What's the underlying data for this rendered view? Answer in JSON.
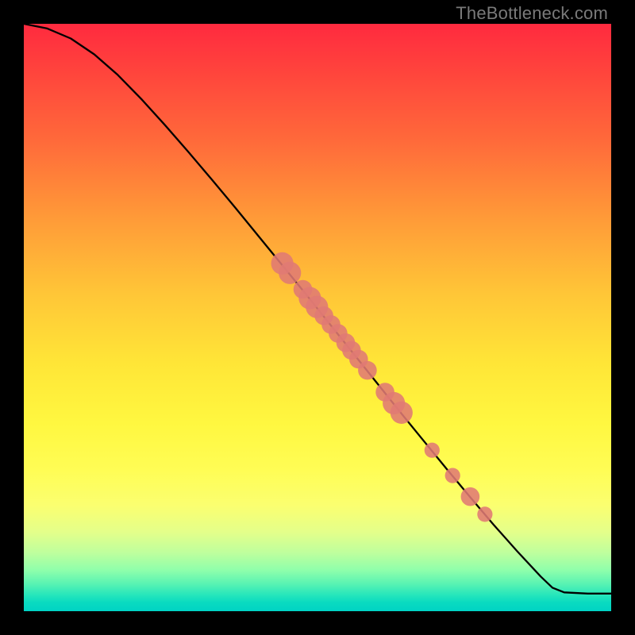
{
  "watermark": "TheBottleneck.com",
  "colors": {
    "dot": "#e07a74",
    "curve": "#000000"
  },
  "chart_data": {
    "type": "line",
    "title": "",
    "xlabel": "",
    "ylabel": "",
    "xlim": [
      0,
      100
    ],
    "ylim": [
      0,
      100
    ],
    "grid": false,
    "legend": null,
    "series": [
      {
        "name": "curve",
        "x": [
          0,
          4,
          8,
          12,
          16,
          20,
          24,
          28,
          32,
          36,
          40,
          44,
          48,
          52,
          56,
          60,
          64,
          68,
          72,
          76,
          80,
          84,
          88,
          90,
          92,
          96,
          100
        ],
        "y": [
          100,
          99.2,
          97.5,
          94.8,
          91.3,
          87.2,
          82.8,
          78.2,
          73.5,
          68.7,
          63.8,
          58.9,
          54.0,
          49.0,
          44.0,
          39.0,
          34.0,
          29.1,
          24.2,
          19.4,
          14.7,
          10.2,
          5.9,
          4.0,
          3.2,
          3.0,
          3.0
        ]
      }
    ],
    "points": [
      {
        "x": 44.0,
        "y": 59.2,
        "r": 1.9
      },
      {
        "x": 45.3,
        "y": 57.6,
        "r": 1.9
      },
      {
        "x": 47.5,
        "y": 54.8,
        "r": 1.6
      },
      {
        "x": 48.7,
        "y": 53.3,
        "r": 1.9
      },
      {
        "x": 49.9,
        "y": 51.8,
        "r": 1.9
      },
      {
        "x": 51.1,
        "y": 50.3,
        "r": 1.6
      },
      {
        "x": 52.3,
        "y": 48.8,
        "r": 1.6
      },
      {
        "x": 53.5,
        "y": 47.3,
        "r": 1.6
      },
      {
        "x": 54.8,
        "y": 45.7,
        "r": 1.6
      },
      {
        "x": 55.8,
        "y": 44.4,
        "r": 1.6
      },
      {
        "x": 57.0,
        "y": 42.9,
        "r": 1.6
      },
      {
        "x": 58.5,
        "y": 41.0,
        "r": 1.6
      },
      {
        "x": 61.5,
        "y": 37.3,
        "r": 1.6
      },
      {
        "x": 63.0,
        "y": 35.4,
        "r": 1.9
      },
      {
        "x": 64.3,
        "y": 33.8,
        "r": 1.9
      },
      {
        "x": 69.5,
        "y": 27.4,
        "r": 1.3
      },
      {
        "x": 73.0,
        "y": 23.1,
        "r": 1.3
      },
      {
        "x": 76.0,
        "y": 19.5,
        "r": 1.6
      },
      {
        "x": 78.5,
        "y": 16.5,
        "r": 1.3
      }
    ]
  }
}
